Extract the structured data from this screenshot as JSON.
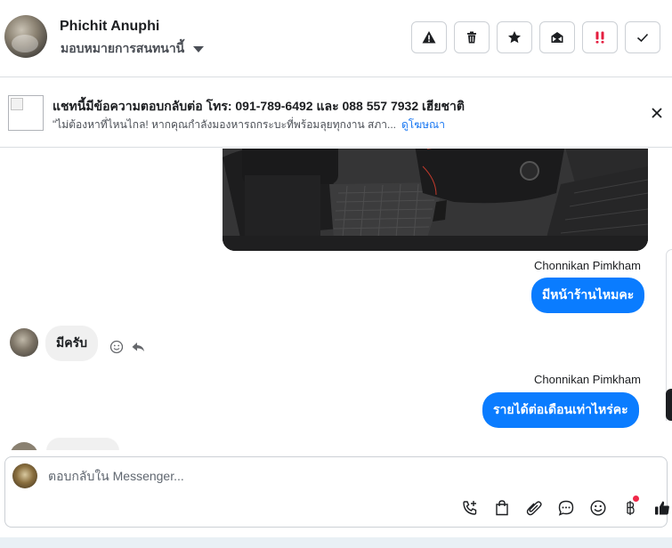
{
  "header": {
    "contact_name": "Phichit Anuphi",
    "assign_label": "มอบหมายการสนทนานี้",
    "action_buttons": [
      {
        "icon": "warning-icon",
        "color": "#1c1e21"
      },
      {
        "icon": "trash-icon",
        "color": "#1c1e21"
      },
      {
        "icon": "star-icon",
        "color": "#1c1e21"
      },
      {
        "icon": "mark-unread-icon",
        "color": "#1c1e21"
      },
      {
        "icon": "important-icon",
        "color": "#e41e3f"
      },
      {
        "icon": "check-icon",
        "color": "#1c1e21"
      }
    ]
  },
  "ad": {
    "title": "แชทนี้มีข้อความตอบกลับต่อ โทร: 091-789-6492 และ 088 557 7932 เฮียชาติ",
    "subtitle": "\"ไม่ต้องหาที่ไหนไกล! หากคุณกำลังมองหารถกระบะที่พร้อมลุยทุกงาน สภา...",
    "link_label": "ดูโฆษณา"
  },
  "conversation": {
    "messages": [
      {
        "direction": "out",
        "sender": "Chonnikan Pimkham",
        "text": "มีหน้าร้านไหมคะ"
      },
      {
        "direction": "in",
        "text": "มีครับ"
      },
      {
        "direction": "out",
        "sender": "Chonnikan Pimkham",
        "text": "รายได้ต่อเดือนเท่าไหร่คะ"
      }
    ]
  },
  "composer": {
    "placeholder": "ตอบกลับใน Messenger..."
  },
  "colors": {
    "accent": "#0a7cff",
    "link": "#1877f2",
    "notification": "#f02849"
  }
}
